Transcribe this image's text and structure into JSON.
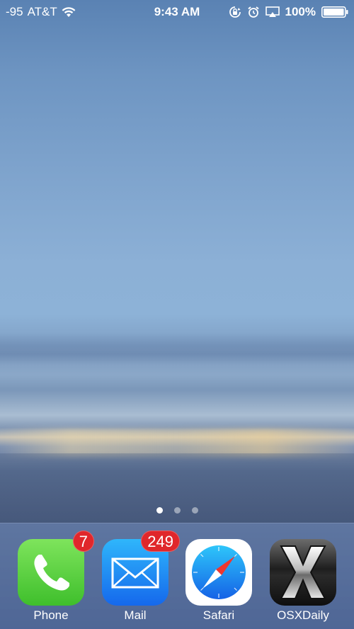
{
  "status_bar": {
    "signal": "-95",
    "carrier": "AT&T",
    "time": "9:43 AM",
    "battery_percent": "100%",
    "battery_level": 1.0,
    "icons": [
      "wifi-icon",
      "rotation-lock-icon",
      "alarm-icon",
      "airplay-icon",
      "battery-icon"
    ]
  },
  "page_indicator": {
    "total_pages": 3,
    "current_page": 1
  },
  "dock": {
    "apps": [
      {
        "label": "Phone",
        "badge": "7",
        "icon": "phone-icon"
      },
      {
        "label": "Mail",
        "badge": "249",
        "icon": "mail-icon"
      },
      {
        "label": "Safari",
        "badge": "",
        "icon": "safari-icon"
      },
      {
        "label": "OSXDaily",
        "badge": "",
        "icon": "osxdaily-icon"
      }
    ]
  },
  "colors": {
    "badge": "#e0272b",
    "phone_green": "#4cd137",
    "mail_blue": "#1e88f0"
  }
}
